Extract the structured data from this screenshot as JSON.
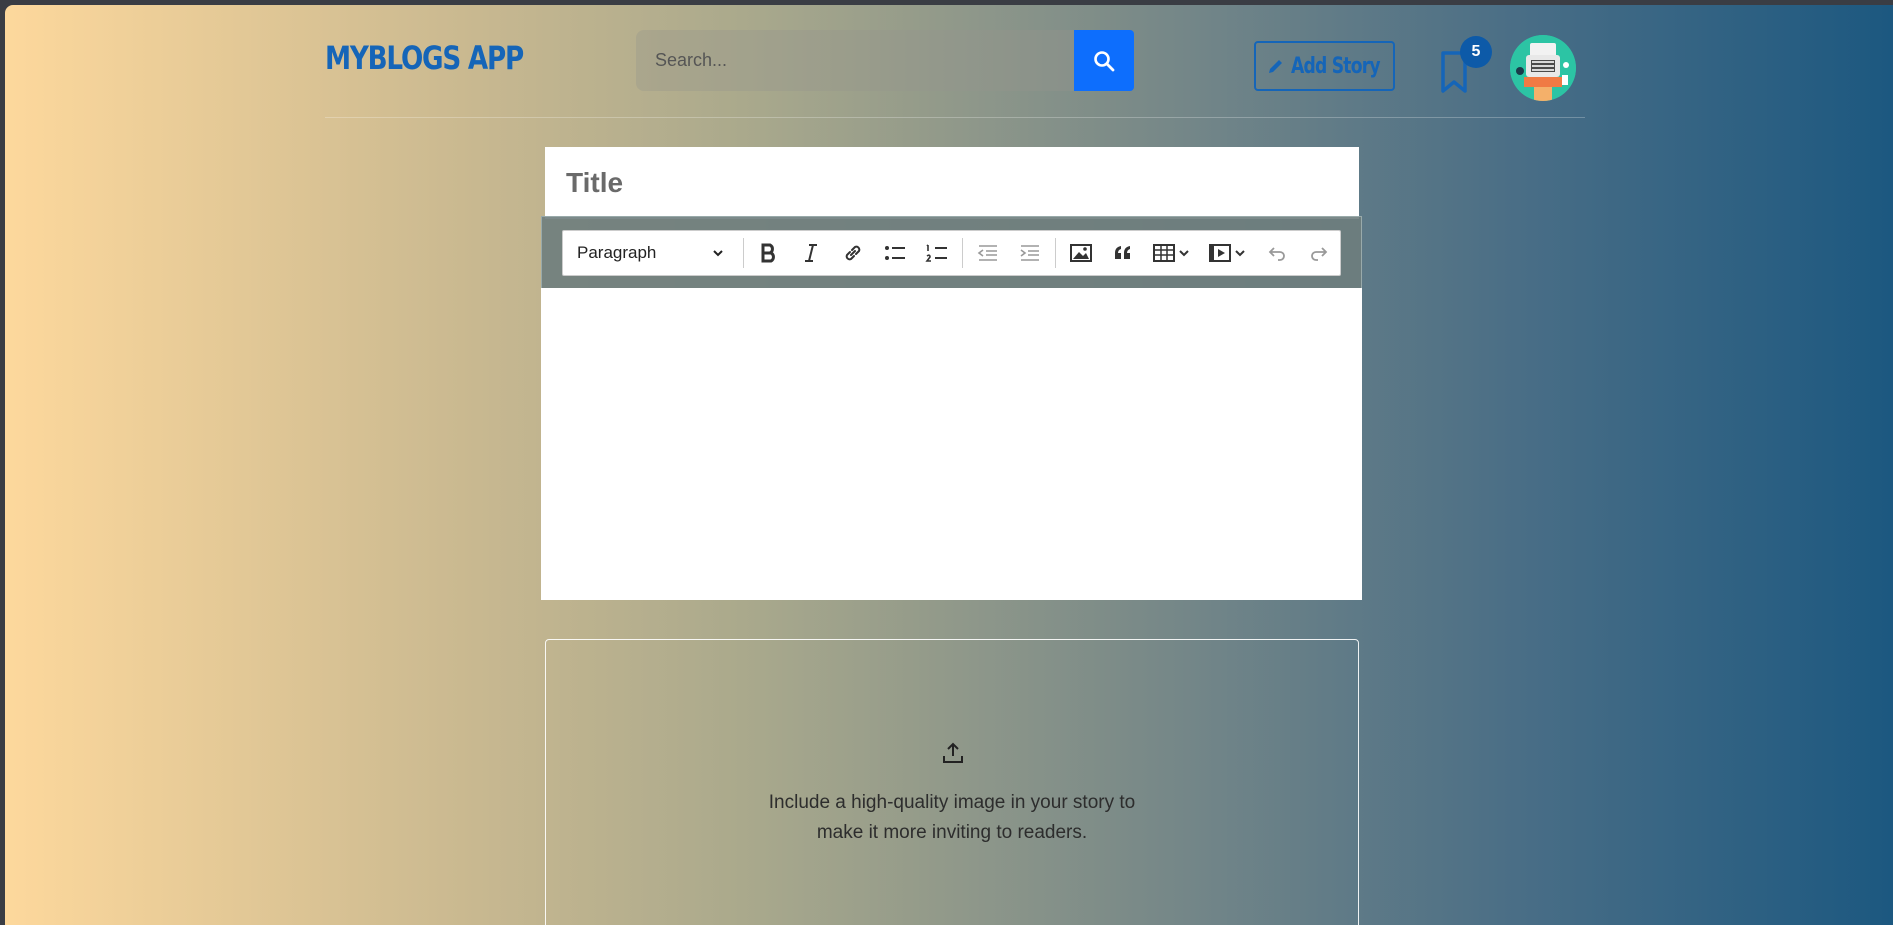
{
  "header": {
    "logo": "MYBLOGS APP",
    "search_placeholder": "Search...",
    "add_story_label": "Add Story",
    "bookmark_count": "5"
  },
  "editor": {
    "title_placeholder": "Title",
    "toolbar": {
      "heading_select": "Paragraph",
      "buttons": [
        "bold-icon",
        "italic-icon",
        "link-icon",
        "bulleted-list-icon",
        "numbered-list-icon",
        "outdent-icon",
        "indent-icon",
        "image-icon",
        "quote-icon",
        "table-icon",
        "media-icon",
        "undo-icon",
        "redo-icon"
      ]
    }
  },
  "upload": {
    "line1": "Include a high-quality image in your story to",
    "line2": "make it more inviting to readers."
  },
  "colors": {
    "brand": "#1565b8",
    "search_button": "#0d6efd",
    "badge": "#0d5aa8"
  }
}
